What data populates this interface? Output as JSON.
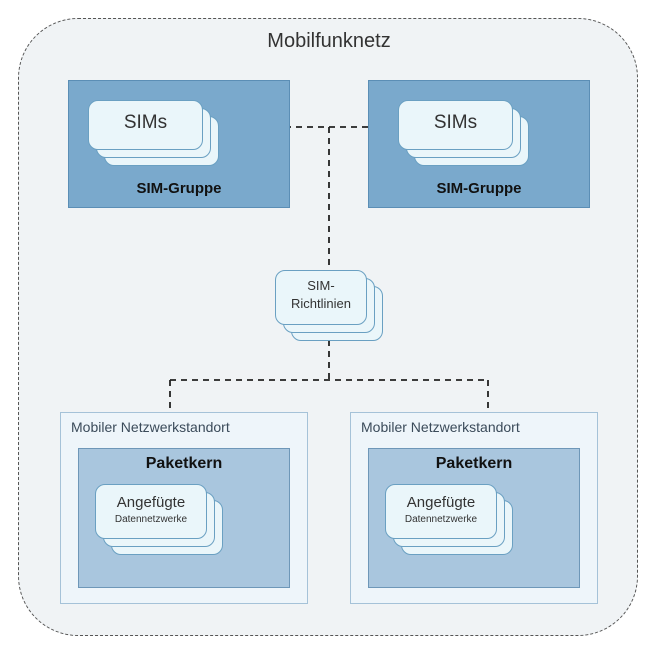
{
  "diagram": {
    "title": "Mobilfunknetz",
    "sim_group_left": {
      "label": "SIM-Gruppe",
      "card": "SIMs"
    },
    "sim_group_right": {
      "label": "SIM-Gruppe",
      "card": "SIMs"
    },
    "policies": {
      "line1": "SIM-",
      "line2": "Richtlinien"
    },
    "site_left": {
      "label": "Mobiler Netzwerkstandort",
      "core": "Paketkern",
      "attached_line1": "Angefügte",
      "attached_line2": "Datennetzwerke"
    },
    "site_right": {
      "label": "Mobiler Netzwerkstandort",
      "core": "Paketkern",
      "attached_line1": "Angefügte",
      "attached_line2": "Datennetzwerke"
    }
  }
}
